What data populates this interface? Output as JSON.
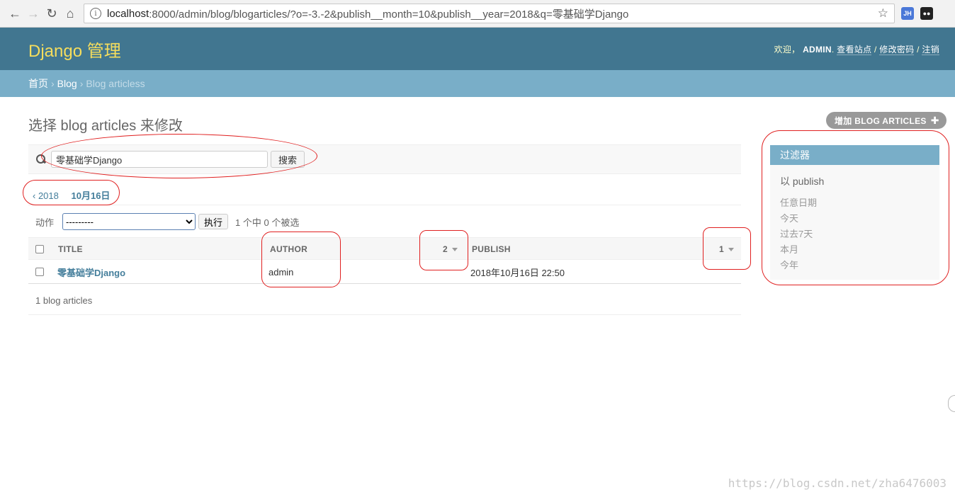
{
  "browser": {
    "url_host": "localhost",
    "url_rest": ":8000/admin/blog/blogarticles/?o=-3.-2&publish__month=10&publish__year=2018&q=零基础学Django",
    "ext1": "JH"
  },
  "header": {
    "brand": "Django 管理",
    "welcome": "欢迎，",
    "user": "ADMIN",
    "view_site": "查看站点",
    "change_password": "修改密码",
    "logout": "注销",
    "sep": " / "
  },
  "breadcrumbs": {
    "home": "首页",
    "app": "Blog",
    "current": "Blog articless",
    "sep": "›"
  },
  "page": {
    "title": "选择 blog articles 来修改",
    "add_button": "增加 BLOG ARTICLES"
  },
  "search": {
    "value": "零基础学Django",
    "button": "搜索"
  },
  "date_hierarchy": {
    "back": "‹ 2018",
    "current": "10月16日"
  },
  "actions": {
    "label": "动作",
    "selected": "---------",
    "go": "执行",
    "counter": "1 个中 0 个被选"
  },
  "table": {
    "columns": {
      "title": "TITLE",
      "author": "AUTHOR",
      "author_sort": "2",
      "publish": "PUBLISH",
      "publish_sort": "1"
    },
    "rows": [
      {
        "title": "零基础学Django",
        "author": "admin",
        "publish": "2018年10月16日 22:50"
      }
    ]
  },
  "paginator": "1 blog articles",
  "filter": {
    "heading": "过滤器",
    "subheading": "以 publish",
    "items": [
      "任意日期",
      "今天",
      "过去7天",
      "本月",
      "今年"
    ]
  },
  "watermark": "https://blog.csdn.net/zha6476003"
}
